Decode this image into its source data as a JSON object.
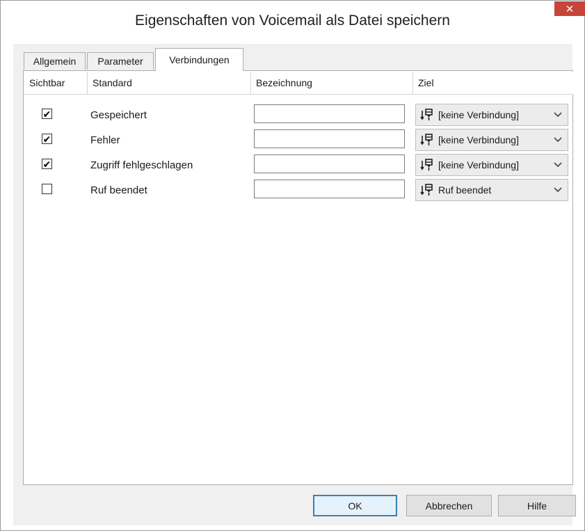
{
  "window": {
    "title": "Eigenschaften von Voicemail als Datei speichern",
    "close_label": "✕",
    "accent_close_color": "#c7443a"
  },
  "tabs": [
    {
      "label": "Allgemein",
      "active": false
    },
    {
      "label": "Parameter",
      "active": false
    },
    {
      "label": "Verbindungen",
      "active": true
    }
  ],
  "table": {
    "columns": [
      "Sichtbar",
      "Standard",
      "Bezeichnung",
      "Ziel"
    ],
    "rows": [
      {
        "visible": true,
        "standard": "Gespeichert",
        "bezeichnung": "",
        "ziel": "[keine Verbindung]"
      },
      {
        "visible": true,
        "standard": "Fehler",
        "bezeichnung": "",
        "ziel": "[keine Verbindung]"
      },
      {
        "visible": true,
        "standard": "Zugriff fehlgeschlagen",
        "bezeichnung": "",
        "ziel": "[keine Verbindung]"
      },
      {
        "visible": false,
        "standard": "Ruf beendet",
        "bezeichnung": "",
        "ziel": "Ruf beendet"
      }
    ]
  },
  "buttons": {
    "ok": "OK",
    "cancel": "Abbrechen",
    "help": "Hilfe"
  },
  "icons": {
    "close": "close-icon",
    "connection": "connection-icon",
    "dropdown": "chevron-down-icon",
    "check": "checkmark-icon"
  }
}
